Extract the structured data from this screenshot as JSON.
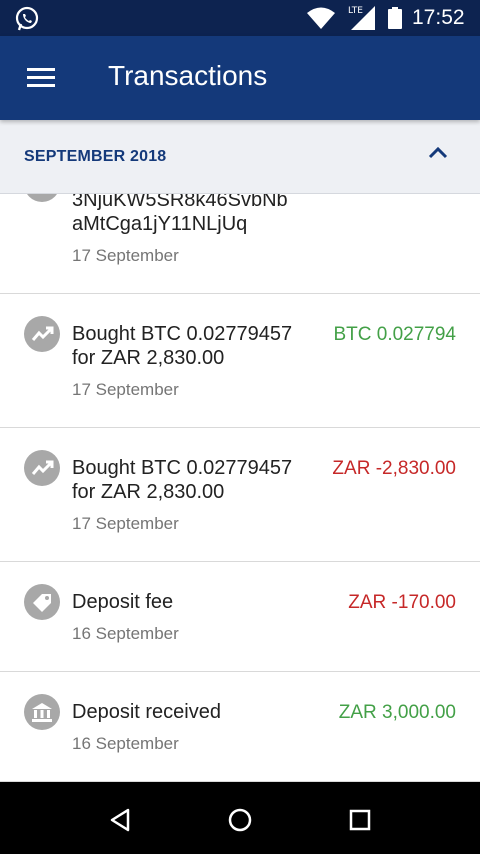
{
  "status_bar": {
    "time": "17:52",
    "network": "LTE"
  },
  "app_bar": {
    "title": "Transactions"
  },
  "section": {
    "label": "SEPTEMBER 2018"
  },
  "transactions": [
    {
      "desc_line1": "3NjuKW5SR8k46SvbNb",
      "desc_line2": "aMtCga1jY11NLjUq",
      "date": "17 September",
      "amount": "",
      "icon": "trending-up-icon"
    },
    {
      "desc_line1": "Bought BTC 0.02779457",
      "desc_line2": "for ZAR 2,830.00",
      "date": "17 September",
      "amount": "BTC 0.027794",
      "icon": "trending-up-icon"
    },
    {
      "desc_line1": "Bought BTC 0.02779457",
      "desc_line2": "for ZAR 2,830.00",
      "date": "17 September",
      "amount": "ZAR -2,830.00",
      "icon": "trending-up-icon"
    },
    {
      "desc_line1": "Deposit fee",
      "date": "16 September",
      "amount": "ZAR -170.00",
      "icon": "tag-icon"
    },
    {
      "desc_line1": "Deposit received",
      "date": "16 September",
      "amount": "ZAR 3,000.00",
      "icon": "bank-icon"
    }
  ],
  "colors": {
    "app_bar": "#14397a",
    "status_bar": "#0d2350",
    "positive": "#43a047",
    "negative": "#c62828"
  }
}
